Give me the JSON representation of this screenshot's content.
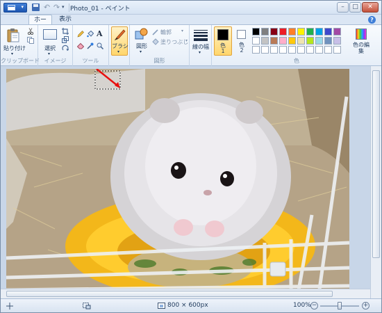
{
  "window": {
    "title": "Photo_01 - ペイント",
    "quick_access": [
      "save-icon",
      "undo-icon",
      "redo-icon",
      "customize-icon"
    ]
  },
  "tabs": [
    {
      "label": "ホーム",
      "active": true
    },
    {
      "label": "表示",
      "active": false
    }
  ],
  "ribbon": {
    "clipboard": {
      "group_label": "クリップボード",
      "paste_label": "貼り付け"
    },
    "image": {
      "group_label": "イメージ",
      "select_label": "選択"
    },
    "tools": {
      "group_label": "ツール"
    },
    "brushes": {
      "label": "ブラシ"
    },
    "shapes": {
      "group_label": "図形",
      "shapes_label": "図形",
      "outline_label": "輪郭",
      "fill_label": "塗りつぶし"
    },
    "size": {
      "label": "線の幅"
    },
    "colors": {
      "group_label": "色",
      "color1_label": "色",
      "color1_num": "1",
      "color2_label": "色",
      "color2_num": "2",
      "edit_label": "色の編集",
      "color1_value": "#000000",
      "color2_value": "#ffffff",
      "palette_row1": [
        "#000000",
        "#7f7f7f",
        "#880015",
        "#ed1c24",
        "#ff7f27",
        "#fff200",
        "#22b14c",
        "#00a2e8",
        "#3f48cc",
        "#a349a4"
      ],
      "palette_row2": [
        "#ffffff",
        "#c3c3c3",
        "#b97a57",
        "#ffaec9",
        "#ffc90e",
        "#efe4b0",
        "#b5e61d",
        "#99d9ea",
        "#7092be",
        "#c8bfe7"
      ],
      "palette_row3": [
        "#ffffff",
        "#ffffff",
        "#ffffff",
        "#ffffff",
        "#ffffff",
        "#ffffff",
        "#ffffff",
        "#ffffff",
        "#ffffff",
        "#ffffff"
      ]
    }
  },
  "status": {
    "dimensions": "800 × 600px",
    "zoom": "100%",
    "zoom_slider_level": 0.5
  }
}
